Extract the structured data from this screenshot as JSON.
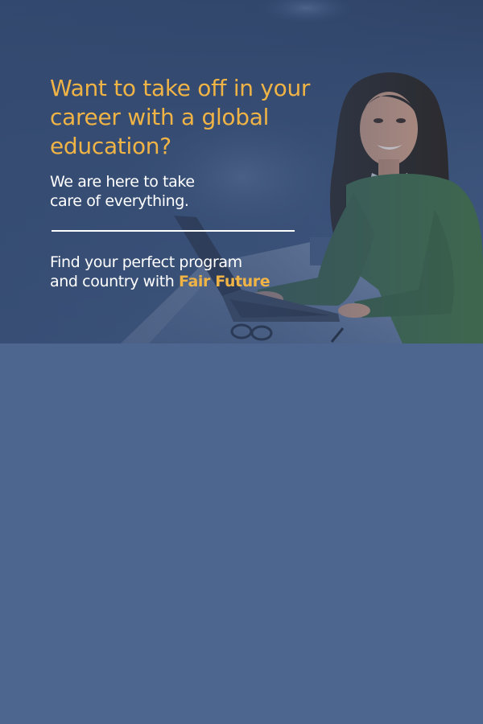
{
  "hero": {
    "headline_line1": "Want to take off in your",
    "headline_line2": "career with a global",
    "headline_line3": "education?",
    "sub_line1": "We are here to take",
    "sub_line2": "care of everything.",
    "cta_line1": "Find your perfect program",
    "cta_line2_prefix": "and country with ",
    "brand_name": "Fair Future"
  },
  "colors": {
    "accent": "#f0b446",
    "background": "#4c6690",
    "text": "#ffffff"
  }
}
